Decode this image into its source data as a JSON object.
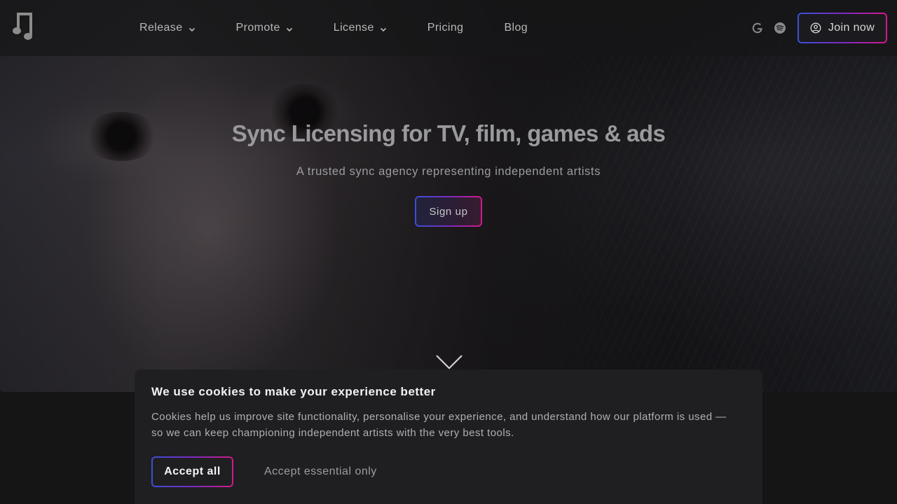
{
  "header": {
    "nav": [
      {
        "label": "Release",
        "has_dropdown": true
      },
      {
        "label": "Promote",
        "has_dropdown": true
      },
      {
        "label": "License",
        "has_dropdown": true
      },
      {
        "label": "Pricing",
        "has_dropdown": false
      },
      {
        "label": "Blog",
        "has_dropdown": false
      }
    ],
    "social_icons": [
      "google-icon",
      "spotify-icon"
    ],
    "join_label": "Join now"
  },
  "hero": {
    "title": "Sync Licensing for TV, film, games & ads",
    "subtitle": "A trusted sync agency representing independent artists",
    "signup_label": "Sign up"
  },
  "cookie_banner": {
    "title": "We use cookies to make your experience better",
    "body": "Cookies help us improve site functionality, personalise your experience, and understand how our platform is used — so we can keep championing independent artists with the very best tools.",
    "accept_all_label": "Accept all",
    "accept_essential_label": "Accept essential only"
  },
  "colors": {
    "accent_gradient_start": "#3a4fd8",
    "accent_gradient_mid": "#7a2bc0",
    "accent_gradient_end": "#d21a8a",
    "banner_background": "#1f1f21"
  }
}
